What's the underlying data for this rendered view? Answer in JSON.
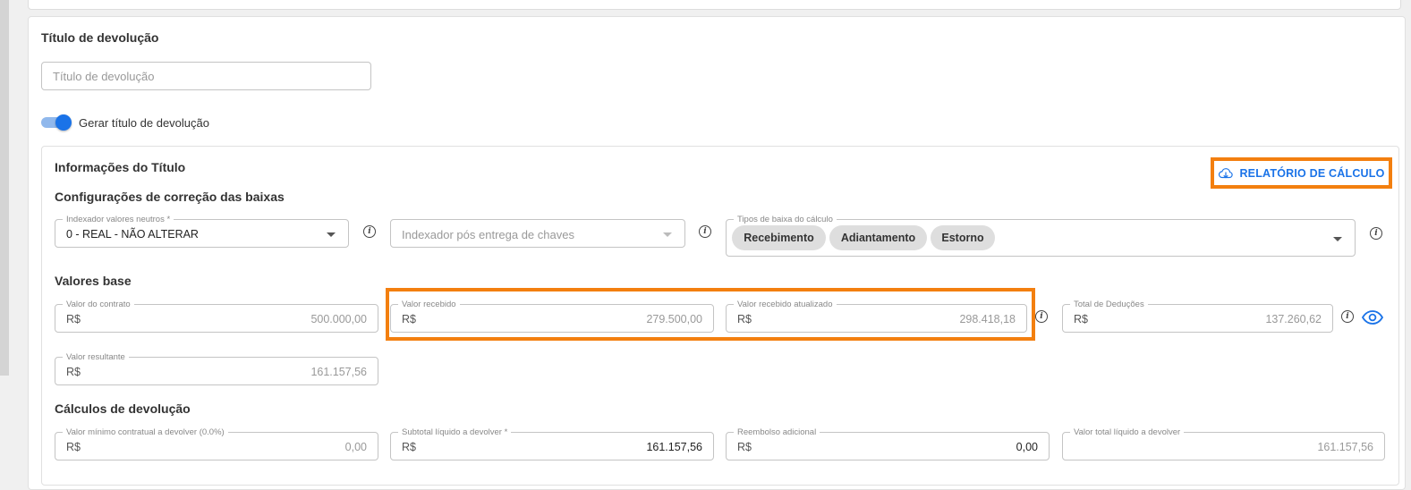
{
  "return_title": {
    "heading": "Título de devolução",
    "input_placeholder": "Título de devolução",
    "toggle_label": "Gerar título de devolução",
    "toggle_on": true
  },
  "title_info": {
    "heading": "Informações do Título",
    "report_button": "RELATÓRIO DE CÁLCULO",
    "report_icon": "cloud-download-icon",
    "accent_color": "#1a73e8",
    "highlight_color": "#f37f0f"
  },
  "correction": {
    "heading": "Configurações de correção das baixas",
    "neutral_indexer": {
      "legend": "Indexador valores neutros *",
      "value": "0 - REAL - NÃO ALTERAR"
    },
    "post_keys_indexer": {
      "placeholder": "Indexador pós entrega de chaves"
    },
    "payment_types": {
      "legend": "Tipos de baixa do cálculo",
      "chips": [
        "Recebimento",
        "Adiantamento",
        "Estorno"
      ]
    }
  },
  "base_values": {
    "heading": "Valores base",
    "contract": {
      "legend": "Valor do contrato",
      "prefix": "R$",
      "value": "500.000,00"
    },
    "received": {
      "legend": "Valor recebido",
      "prefix": "R$",
      "value": "279.500,00"
    },
    "received_updated": {
      "legend": "Valor recebido atualizado",
      "prefix": "R$",
      "value": "298.418,18"
    },
    "deductions": {
      "legend": "Total de Deduções",
      "prefix": "R$",
      "value": "137.260,62"
    },
    "resulting": {
      "legend": "Valor resultante",
      "prefix": "R$",
      "value": "161.157,56"
    }
  },
  "return_calc": {
    "heading": "Cálculos de devolução",
    "minimum": {
      "legend": "Valor mínimo contratual a devolver (0.0%)",
      "prefix": "R$",
      "value": "0,00"
    },
    "subtotal": {
      "legend": "Subtotal líquido a devolver *",
      "prefix": "R$",
      "value": "161.157,56"
    },
    "reimbursement": {
      "legend": "Reembolso adicional",
      "prefix": "R$",
      "value": "0,00"
    },
    "total": {
      "legend": "Valor total líquido a devolver",
      "value": "161.157,56"
    }
  }
}
